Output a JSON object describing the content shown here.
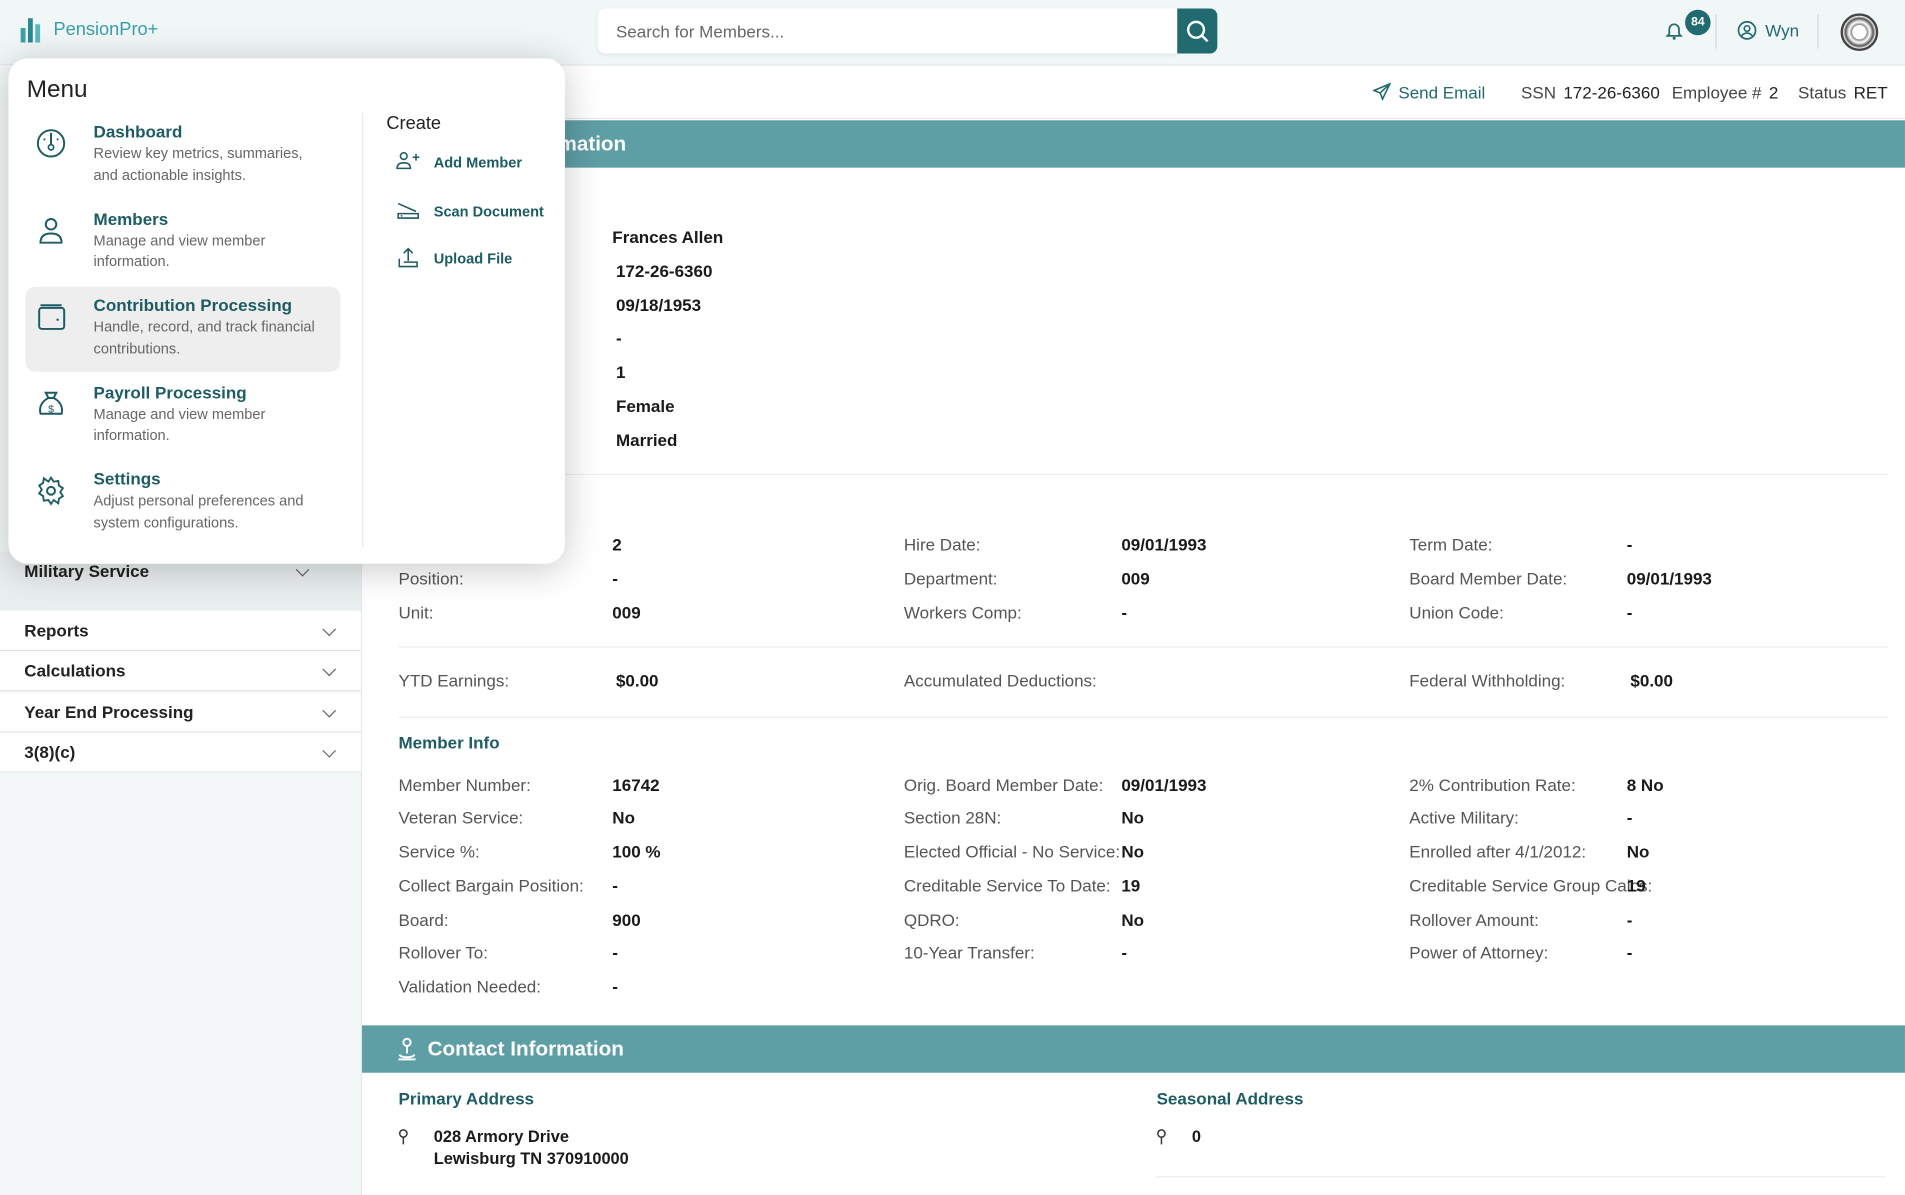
{
  "header": {
    "app_name": "PensionPro+",
    "search_placeholder": "Search for Members...",
    "notification_count": "84",
    "user_name": "Wyn"
  },
  "subbar": {
    "send_email": "Send Email",
    "ssn_label": "SSN",
    "ssn": "172-26-6360",
    "employee_label": "Employee #",
    "employee": "2",
    "status_label": "Status",
    "status": "RET"
  },
  "sidebar": {
    "items": [
      {
        "label": "Military Service"
      },
      {
        "label": "Reports"
      },
      {
        "label": "Calculations"
      },
      {
        "label": "Year End Processing"
      },
      {
        "label": "3(8)(c)"
      }
    ]
  },
  "member_section": {
    "title": "Member Information",
    "personal_values": [
      "Frances Allen",
      "172-26-6360",
      "09/18/1953",
      "-",
      "1",
      "Female",
      "Married"
    ]
  },
  "employment": [
    [
      {
        "label": "",
        "value": "2"
      },
      {
        "label": "Hire Date:",
        "value": "09/01/1993"
      },
      {
        "label": "Term Date:",
        "value": "-"
      }
    ],
    [
      {
        "label": "Position:",
        "value": "-"
      },
      {
        "label": "Department:",
        "value": "009"
      },
      {
        "label": "Board Member Date:",
        "value": "09/01/1993"
      }
    ],
    [
      {
        "label": "Unit:",
        "value": "009"
      },
      {
        "label": "Workers Comp:",
        "value": "-"
      },
      {
        "label": "Union Code:",
        "value": "-"
      }
    ]
  ],
  "earnings": [
    {
      "label": "YTD Earnings:",
      "value": "$0.00"
    },
    {
      "label": "Accumulated Deductions:",
      "value": ""
    },
    {
      "label": "Federal Withholding:",
      "value": "$0.00"
    }
  ],
  "member_info": {
    "title": "Member Info",
    "rows": [
      [
        {
          "label": "Member Number:",
          "value": "16742"
        },
        {
          "label": "Orig. Board Member Date:",
          "value": "09/01/1993"
        },
        {
          "label": "2% Contribution Rate:",
          "value": "8 No"
        }
      ],
      [
        {
          "label": "Veteran Service:",
          "value": "No"
        },
        {
          "label": "Section 28N:",
          "value": "No"
        },
        {
          "label": "Active Military:",
          "value": "-"
        }
      ],
      [
        {
          "label": "Service %:",
          "value": "100 %"
        },
        {
          "label": "Elected Official - No Service:",
          "value": "No"
        },
        {
          "label": "Enrolled after 4/1/2012:",
          "value": "No"
        }
      ],
      [
        {
          "label": "Collect Bargain Position:",
          "value": "-"
        },
        {
          "label": "Creditable Service To Date:",
          "value": "19"
        },
        {
          "label": "Creditable Service Group Calcs:",
          "value": "19"
        }
      ],
      [
        {
          "label": "Board:",
          "value": "900"
        },
        {
          "label": "QDRO:",
          "value": "No"
        },
        {
          "label": "Rollover Amount:",
          "value": "-"
        }
      ],
      [
        {
          "label": "Rollover To:",
          "value": "-"
        },
        {
          "label": "10-Year Transfer:",
          "value": "-"
        },
        {
          "label": "Power of Attorney:",
          "value": "-"
        }
      ],
      [
        {
          "label": "Validation Needed:",
          "value": "-"
        }
      ]
    ]
  },
  "contact": {
    "title": "Contact Information",
    "primary_title": "Primary Address",
    "primary_line1": "028 Armory Drive",
    "primary_line2": "Lewisburg TN 370910000",
    "seasonal_title": "Seasonal Address",
    "seasonal_line1": "0"
  },
  "menu": {
    "title": "Menu",
    "items": [
      {
        "title": "Dashboard",
        "desc": "Review key metrics, summaries, and actionable insights.",
        "icon": "dashboard-gauge-icon"
      },
      {
        "title": "Members",
        "desc": "Manage and view member information.",
        "icon": "user-icon"
      },
      {
        "title": "Contribution Processing",
        "desc": "Handle, record, and track financial contributions.",
        "icon": "wallet-icon",
        "active": true
      },
      {
        "title": "Payroll Processing",
        "desc": "Manage and view member information.",
        "icon": "money-bag-icon"
      },
      {
        "title": "Settings",
        "desc": "Adjust personal preferences and system configurations.",
        "icon": "gear-icon"
      }
    ],
    "create_title": "Create",
    "create_items": [
      {
        "label": "Add Member",
        "icon": "add-user-icon"
      },
      {
        "label": "Scan Document",
        "icon": "scanner-icon"
      },
      {
        "label": "Upload File",
        "icon": "upload-icon"
      }
    ]
  },
  "colors": {
    "brand": "#206a70",
    "section_header": "#5e9ea5",
    "heading": "#1d5c63"
  }
}
